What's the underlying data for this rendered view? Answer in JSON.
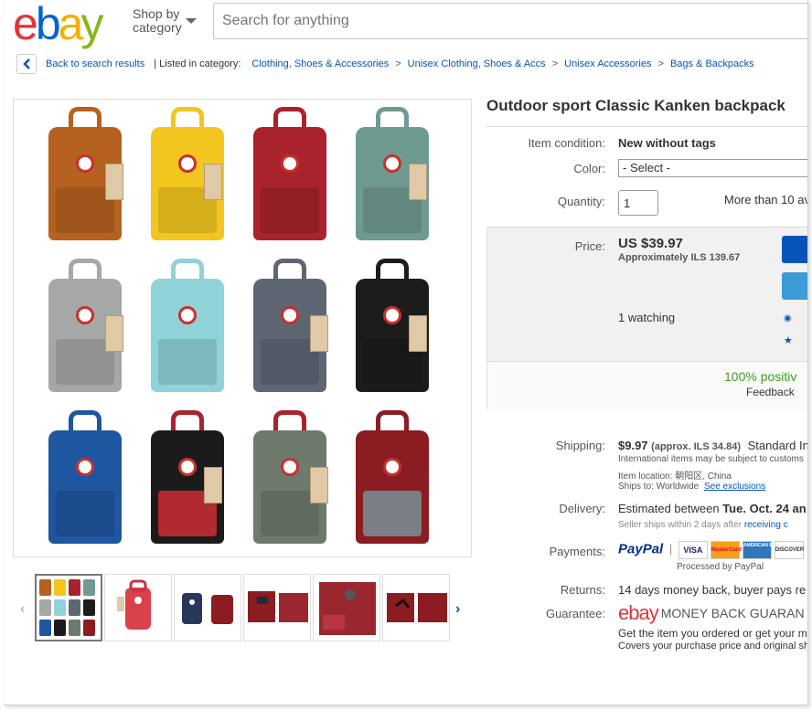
{
  "header": {
    "logo": [
      "e",
      "b",
      "a",
      "y"
    ],
    "logo_colors": [
      "#e53238",
      "#0064d2",
      "#f5af02",
      "#86b817"
    ],
    "shop_by_line1": "Shop by",
    "shop_by_line2": "category",
    "search_placeholder": "Search for anything"
  },
  "breadcrumb": {
    "back": "Back to search results",
    "listed_in": "| Listed in category:",
    "items": [
      "Clothing, Shoes & Accessories",
      "Unisex Clothing, Shoes & Accs",
      "Unisex Accessories",
      "Bags & Backpacks"
    ],
    "separator": ">"
  },
  "item": {
    "title": "Outdoor sport Classic Kanken backpack",
    "condition_label": "Item condition:",
    "condition_value": "New without tags",
    "color_label": "Color:",
    "color_select": "- Select -",
    "quantity_label": "Quantity:",
    "quantity_value": "1",
    "quantity_avail": "More than 10 av",
    "price_label": "Price:",
    "price": "US $39.97",
    "price_approx": "Approximately ILS 139.67",
    "watching": "1 watching",
    "feedback_pct": "100% positiv",
    "feedback_label": "Feedback"
  },
  "shipping": {
    "label": "Shipping:",
    "cost": "$9.97",
    "approx": "(approx. ILS 34.84)",
    "method": "Standard In",
    "note": "International items may be subject to customs",
    "location": "Item location:  朝阳区, China",
    "ships_to_prefix": "Ships to:  Worldwide",
    "ships_to_link": "See exclusions"
  },
  "delivery": {
    "label": "Delivery:",
    "estimate_prefix": "Estimated between",
    "estimate_bold": "Tue. Oct. 24 an",
    "note_prefix": "Seller ships within 2 days after",
    "note_link": "receiving c"
  },
  "payments": {
    "label": "Payments:",
    "paypal": "PayPal",
    "cards": [
      "VISA",
      "MasterCard",
      "AMERICAN EXPRESS",
      "DISCOVER"
    ],
    "processed": "Processed by PayPal"
  },
  "returns": {
    "label": "Returns:",
    "value": "14 days money back, buyer pays re"
  },
  "guarantee": {
    "label": "Guarantee:",
    "logo": "ebay",
    "title": "MONEY BACK GUARAN",
    "line1": "Get the item you ordered or get your m",
    "line2": "Covers your purchase price and original sh"
  },
  "colors": {
    "packs": [
      "#b5611f",
      "#f2c61f",
      "#a8232b",
      "#6f9a92",
      "#a5a8a5",
      "#8fd2d8",
      "#5e6672",
      "#1c1c1c",
      "#1f56a0",
      "#1b1b1b",
      "#6d7a6c",
      "#8b1d22"
    ]
  }
}
